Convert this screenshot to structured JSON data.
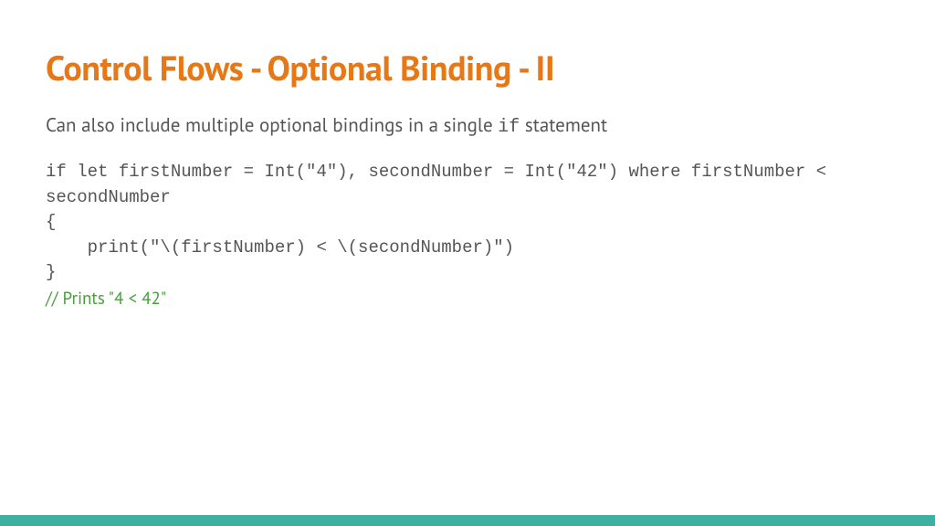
{
  "slide": {
    "title": "Control Flows - Optional Binding - II",
    "description_prefix": "Can also include multiple optional bindings in a single ",
    "description_code": "if",
    "description_suffix": " statement",
    "code": "if let firstNumber = Int(\"4\"), secondNumber = Int(\"42\") where firstNumber < secondNumber\n{\n    print(\"\\(firstNumber) < \\(secondNumber)\")\n}",
    "comment": "// Prints \"4 < 42\""
  },
  "colors": {
    "title": "#e67817",
    "text": "#555555",
    "comment": "#4a9e3f",
    "accent_bar": "#3eb0a1"
  }
}
